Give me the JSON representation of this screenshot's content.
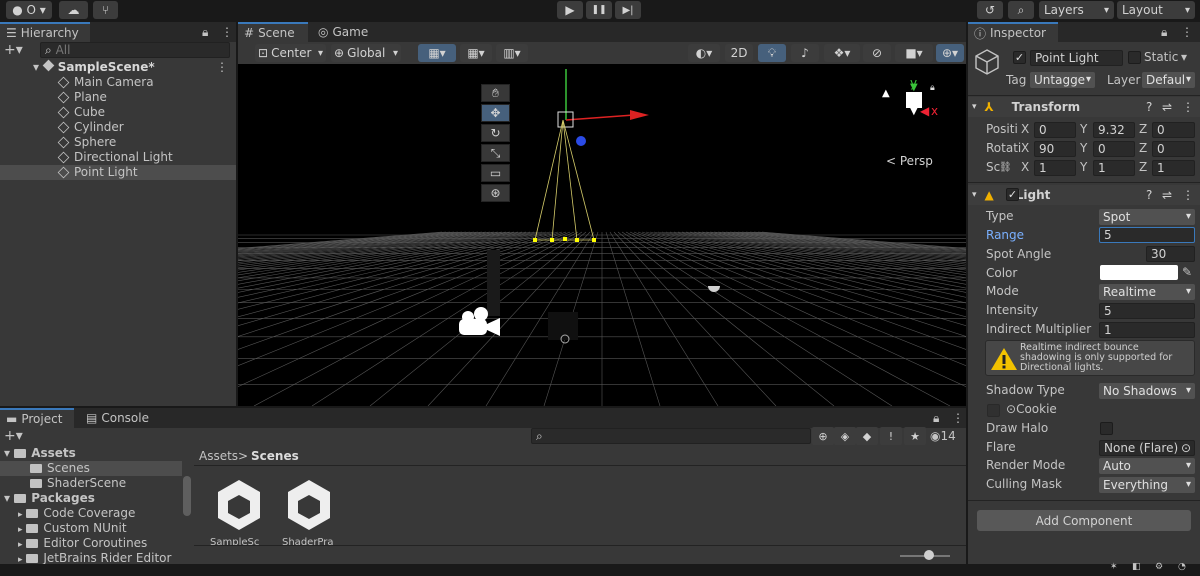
{
  "toolbar": {
    "account": "O",
    "layers": "Layers",
    "layout": "Layout",
    "play": "▶",
    "pause": "❚❚",
    "step": "▶|"
  },
  "hierarchy": {
    "tab": "Hierarchy",
    "search_placeholder": "All",
    "scene": "SampleScene*",
    "items": [
      "Main Camera",
      "Plane",
      "Cube",
      "Cylinder",
      "Sphere",
      "Directional Light",
      "Point Light"
    ]
  },
  "scene_view": {
    "tab_scene": "Scene",
    "tab_game": "Game",
    "pivot": "Center",
    "space": "Global",
    "mode_2d": "2D",
    "persp": "Persp",
    "gizmo_y": "y",
    "gizmo_x": "x"
  },
  "inspector": {
    "tab": "Inspector",
    "object_name": "Point Light",
    "static": "Static",
    "tag_label": "Tag",
    "tag": "Untagge",
    "layer_label": "Layer",
    "layer": "Defaul",
    "transform": {
      "title": "Transform",
      "rows": [
        {
          "label": "Positi",
          "x": "0",
          "y": "9.32",
          "z": "0"
        },
        {
          "label": "Rotati",
          "x": "90",
          "y": "0",
          "z": "0"
        },
        {
          "label": "Sc",
          "x": "1",
          "y": "1",
          "z": "1"
        }
      ]
    },
    "light": {
      "title": "Light",
      "type_label": "Type",
      "type": "Spot",
      "range_label": "Range",
      "range": "5",
      "spot_label": "Spot Angle",
      "spot": "30",
      "color_label": "Color",
      "color": "#ffffff",
      "mode_label": "Mode",
      "mode": "Realtime",
      "intensity_label": "Intensity",
      "intensity": "5",
      "indirect_label": "Indirect Multiplier",
      "indirect": "1",
      "warning": "Realtime indirect bounce shadowing is only supported for Directional lights.",
      "shadow_label": "Shadow Type",
      "shadow": "No Shadows",
      "cookie_label": "Cookie",
      "halo_label": "Draw Halo",
      "flare_label": "Flare",
      "flare": "None (Flare)",
      "render_label": "Render Mode",
      "render": "Auto",
      "cull_label": "Culling Mask",
      "cull": "Everything"
    },
    "add_component": "Add Component"
  },
  "project": {
    "tab_project": "Project",
    "tab_console": "Console",
    "assets": "Assets",
    "scenes": "Scenes",
    "shader_scene": "ShaderScene",
    "packages": "Packages",
    "packages_items": [
      "Code Coverage",
      "Custom NUnit",
      "Editor Coroutines",
      "JetBrains Rider Editor"
    ],
    "breadcrumb_root": "Assets",
    "breadcrumb_sep": ">",
    "breadcrumb_leaf": "Scenes",
    "files": [
      "SampleSc",
      "ShaderPra"
    ],
    "hidden_count": "14"
  },
  "colors": {
    "accent": "#3a79bb",
    "selected": "#4d4d4d"
  }
}
